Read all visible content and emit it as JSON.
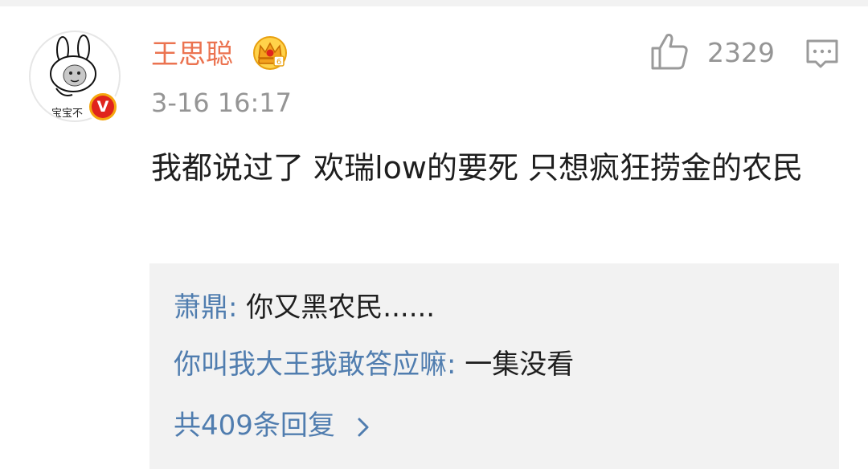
{
  "post": {
    "username": "王思聪",
    "timestamp": "3-16 16:17",
    "like_count": "2329",
    "comment_text": "我都说过了 欢瑞low的要死 只想疯狂捞金的农民",
    "avatar_caption": "宝宝不",
    "verified_badge_letter": "V"
  },
  "replies": [
    {
      "user": "萧鼎",
      "separator": ": ",
      "text": "你又黑农民......"
    },
    {
      "user": "你叫我大王我敢答应嘛",
      "separator": ": ",
      "text": "一集没看"
    }
  ],
  "more_replies_label": "共409条回复",
  "icons": {
    "like": "thumbs-up-icon",
    "comment": "comment-icon",
    "vip": "crown-icon",
    "chevron": "chevron-right-icon"
  },
  "colors": {
    "username": "#eb7350",
    "link": "#507daf",
    "meta": "#959595",
    "text": "#1e1e1e",
    "reply_bg": "#f2f2f2"
  }
}
